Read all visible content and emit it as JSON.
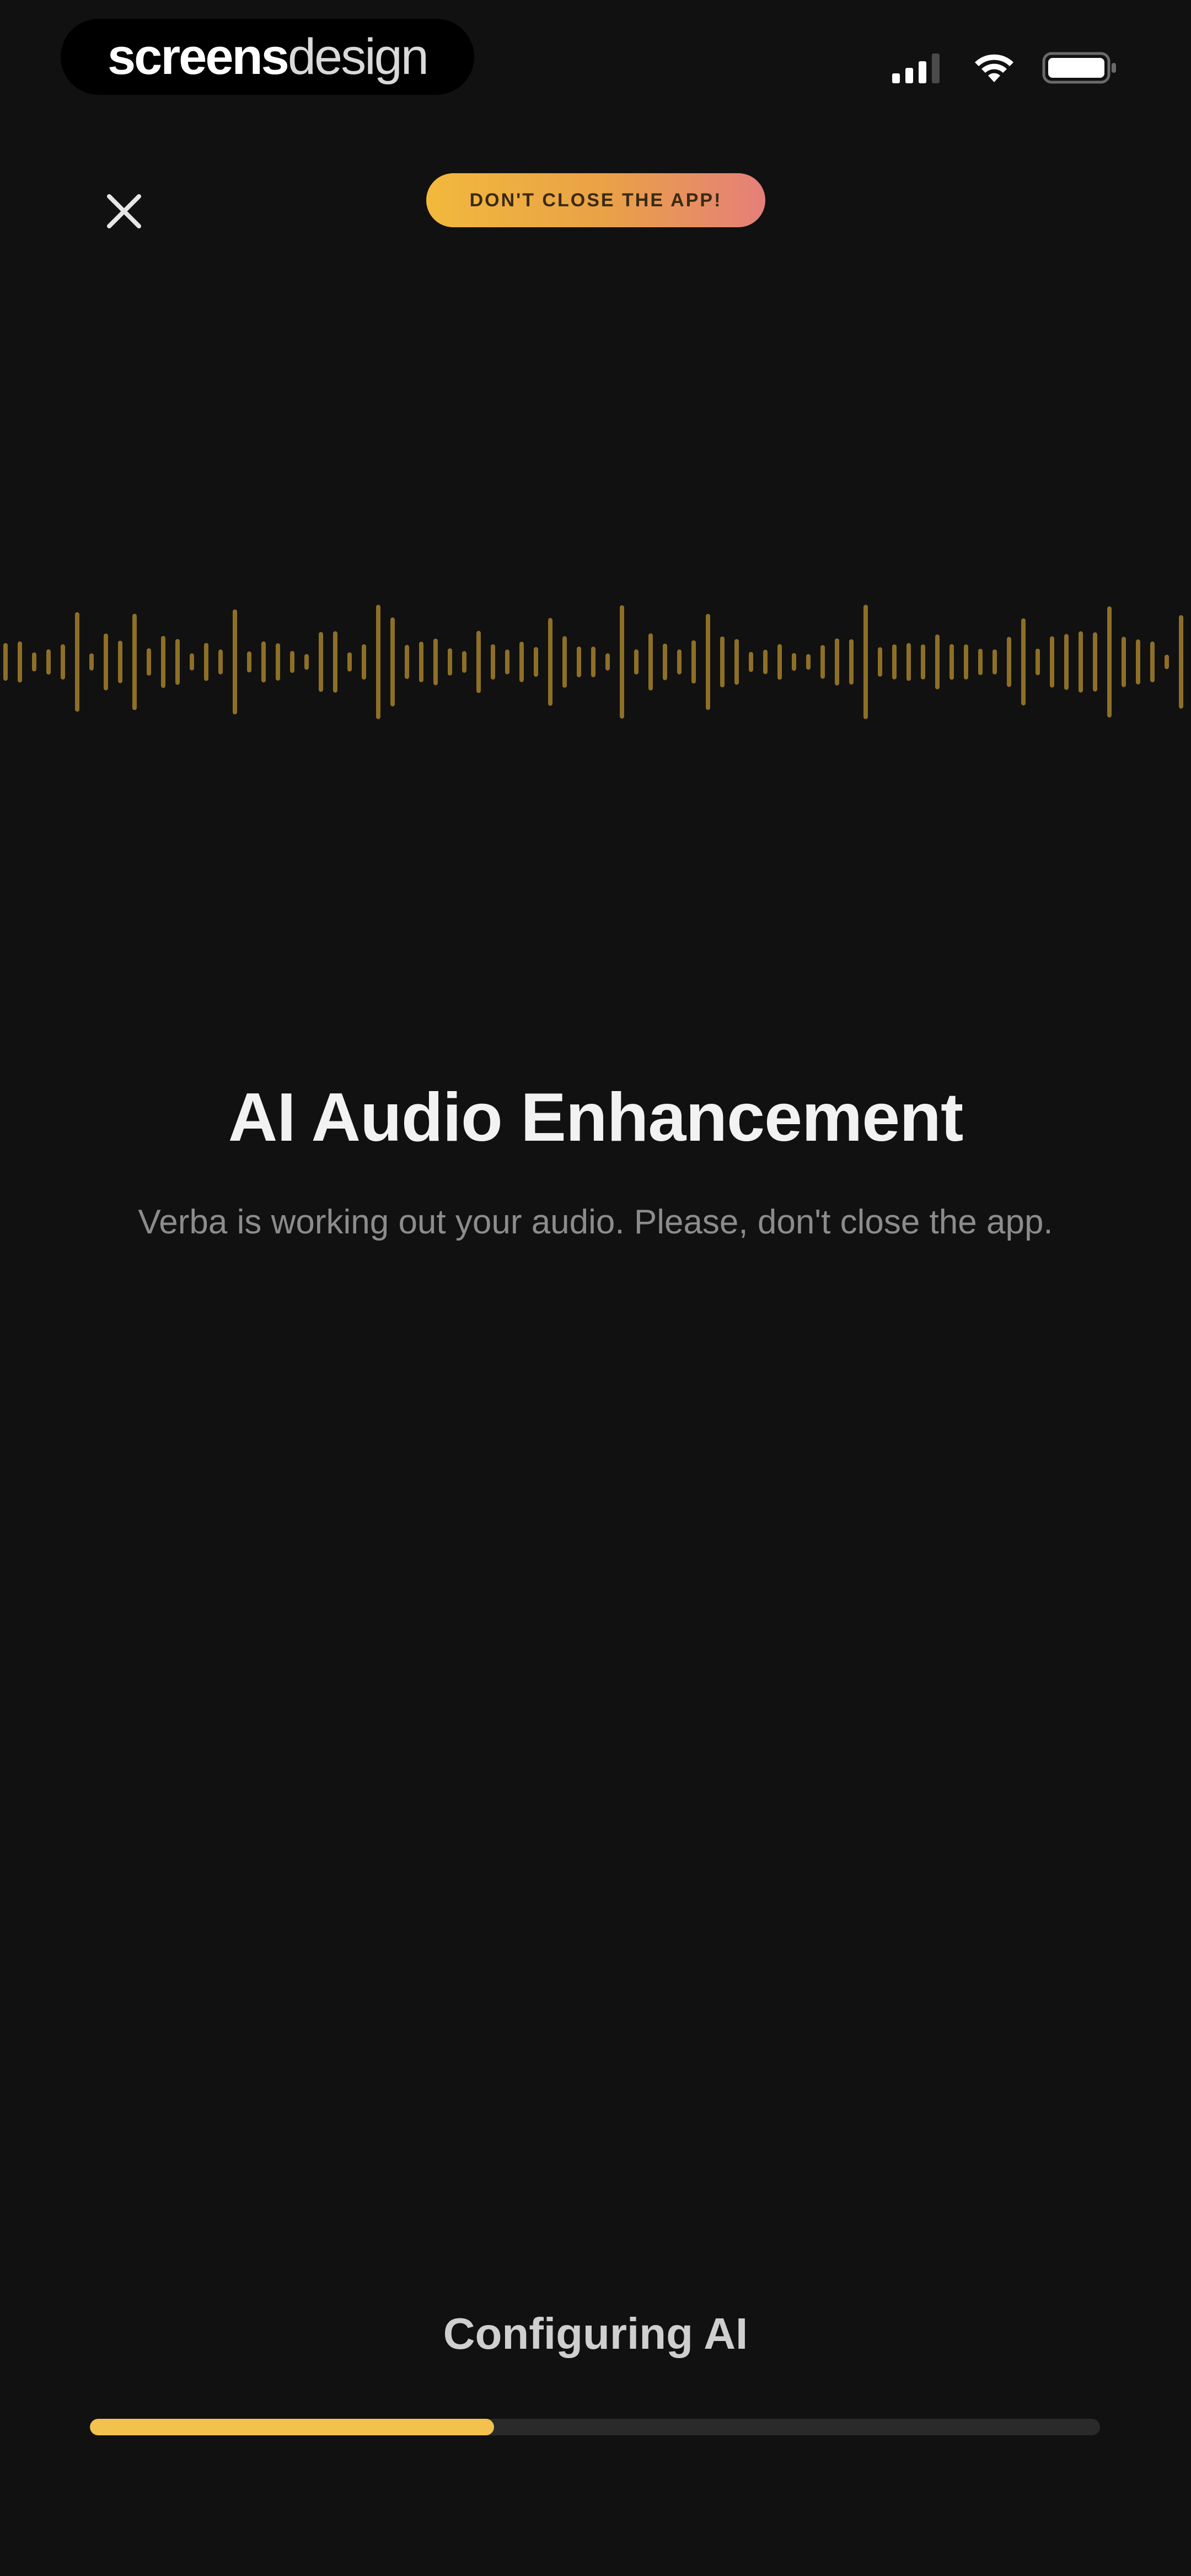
{
  "status_bar": {
    "brand_bold": "screens",
    "brand_light": "design",
    "icons": [
      "cellular-signal-icon",
      "wifi-icon",
      "battery-icon"
    ]
  },
  "header": {
    "close_icon": "close-icon",
    "warning_label": "DON'T CLOSE THE APP!"
  },
  "main": {
    "title": "AI Audio Enhancement",
    "subtitle": "Verba is working out your audio. Please, don't close the app."
  },
  "progress": {
    "label": "Configuring AI",
    "value": 0.4
  },
  "colors": {
    "background": "#111111",
    "accent": "#f2c14e",
    "waveform": "#b88f2e",
    "pill_gradient_start": "#f2b93c",
    "pill_gradient_end": "#e57f7a"
  }
}
